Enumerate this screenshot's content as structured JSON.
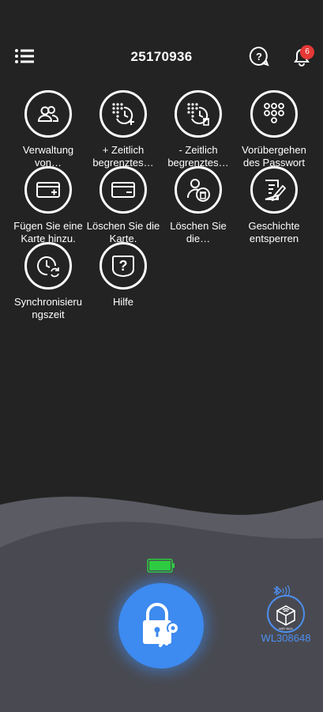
{
  "header": {
    "title": "25170936",
    "notification_count": "6",
    "icons": [
      "list-menu-icon",
      "help-icon",
      "bell-icon"
    ]
  },
  "tiles": [
    {
      "label": "Verwaltung von…",
      "icon": "users-icon"
    },
    {
      "label": "+ Zeitlich begrenztes…",
      "icon": "keypad-clock-add-icon"
    },
    {
      "label": "- Zeitlich begrenztes…",
      "icon": "keypad-clock-delete-icon"
    },
    {
      "label": "Vorübergehen des Passwort",
      "icon": "keypad-icon"
    },
    {
      "label": "Fügen Sie eine Karte hinzu.",
      "icon": "card-add-icon"
    },
    {
      "label": "Löschen Sie die Karte.",
      "icon": "card-remove-icon"
    },
    {
      "label": "Löschen Sie die…",
      "icon": "user-delete-icon"
    },
    {
      "label": "Geschichte entsperren",
      "icon": "history-icon"
    },
    {
      "label": "Synchronisierungszeit",
      "label_display": "Synchronisieru ngszeit",
      "icon": "sync-clock-icon"
    },
    {
      "label": "Hilfe",
      "icon": "help-icon"
    }
  ],
  "bottom": {
    "gateway_label": "WL308648",
    "gateway_box_text": "WiFi BOX",
    "battery_level": 1.0
  },
  "colors": {
    "background": "#232323",
    "accent": "#3d8af0",
    "badge": "#e53935",
    "battery": "#2ecc40",
    "wave_light": "#5a5b63",
    "wave_dark": "#494a51"
  }
}
